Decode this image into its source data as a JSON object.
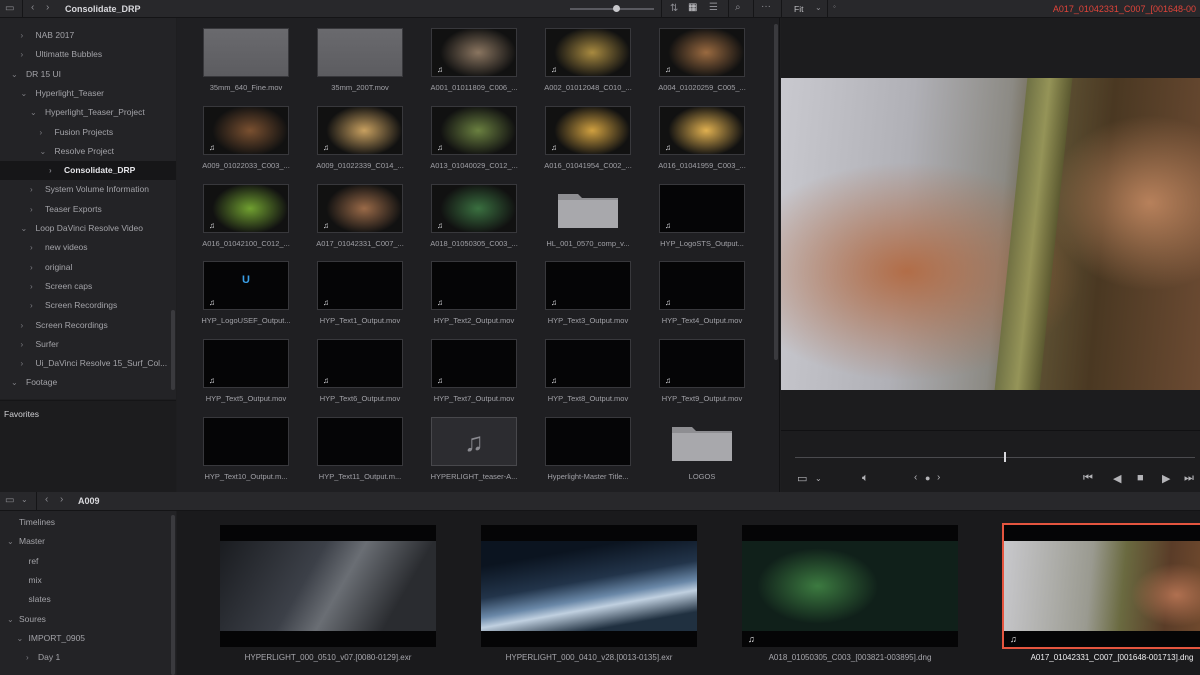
{
  "top": {
    "title": "Consolidate_DRP",
    "fit": "Fit",
    "clip": "A017_01042331_C007_[001648-00"
  },
  "tree": [
    {
      "label": "NAB 2017",
      "depth": 1,
      "chev": "›"
    },
    {
      "label": "Ultimatte Bubbles",
      "depth": 1,
      "chev": "›"
    },
    {
      "label": "DR 15 UI",
      "depth": 0,
      "chev": "⌄"
    },
    {
      "label": "Hyperlight_Teaser",
      "depth": 1,
      "chev": "⌄"
    },
    {
      "label": "Hyperlight_Teaser_Project",
      "depth": 2,
      "chev": "⌄"
    },
    {
      "label": "Fusion Projects",
      "depth": 3,
      "chev": "›"
    },
    {
      "label": "Resolve Project",
      "depth": 3,
      "chev": "⌄"
    },
    {
      "label": "Consolidate_DRP",
      "depth": 4,
      "chev": "›",
      "selected": true
    },
    {
      "label": "System Volume Information",
      "depth": 2,
      "chev": "›"
    },
    {
      "label": "Teaser Exports",
      "depth": 2,
      "chev": "›"
    },
    {
      "label": "Loop DaVinci Resolve Video",
      "depth": 1,
      "chev": "⌄"
    },
    {
      "label": "new videos",
      "depth": 2,
      "chev": "›"
    },
    {
      "label": "original",
      "depth": 2,
      "chev": "›"
    },
    {
      "label": "Screen caps",
      "depth": 2,
      "chev": "›"
    },
    {
      "label": "Screen Recordings",
      "depth": 2,
      "chev": "›"
    },
    {
      "label": "Screen Recordings",
      "depth": 1,
      "chev": "›"
    },
    {
      "label": "Surfer",
      "depth": 1,
      "chev": "›"
    },
    {
      "label": "Ui_DaVinci Resolve 15_Surf_Col...",
      "depth": 1,
      "chev": "›"
    },
    {
      "label": "Footage",
      "depth": 0,
      "chev": "⌄"
    }
  ],
  "favorites": "Favorites",
  "pool": [
    {
      "name": "35mm_640_Fine.mov",
      "kind": "gray"
    },
    {
      "name": "35mm_200T.mov",
      "kind": "gray"
    },
    {
      "name": "A001_01011809_C006_...",
      "kind": "video",
      "tone": "#8a7560",
      "audio": true
    },
    {
      "name": "A002_01012048_C010_...",
      "kind": "video",
      "tone": "#a88a40",
      "audio": true
    },
    {
      "name": "A004_01020259_C005_...",
      "kind": "video",
      "tone": "#9a6a40",
      "audio": true
    },
    {
      "name": "A009_01022033_C003_...",
      "kind": "video",
      "tone": "#7a5030",
      "audio": true
    },
    {
      "name": "A009_01022339_C014_...",
      "kind": "video",
      "tone": "#c8a060",
      "audio": true
    },
    {
      "name": "A013_01040029_C012_...",
      "kind": "video",
      "tone": "#6a8040",
      "audio": true
    },
    {
      "name": "A016_01041954_C002_...",
      "kind": "video",
      "tone": "#d0a040",
      "audio": true
    },
    {
      "name": "A016_01041959_C003_...",
      "kind": "video",
      "tone": "#e0b050",
      "audio": true
    },
    {
      "name": "A016_01042100_C012_...",
      "kind": "video",
      "tone": "#70a030",
      "audio": true
    },
    {
      "name": "A017_01042331_C007_...",
      "kind": "video",
      "tone": "#9a6a48",
      "audio": true
    },
    {
      "name": "A018_01050305_C003_...",
      "kind": "video",
      "tone": "#3a7040",
      "audio": true
    },
    {
      "name": "HL_001_0570_comp_v...",
      "kind": "folder"
    },
    {
      "name": "HYP_LogoSTS_Output...",
      "kind": "dark",
      "audio": true
    },
    {
      "name": "HYP_LogoUSEF_Output...",
      "kind": "dark",
      "audio": true,
      "glyph": "U"
    },
    {
      "name": "HYP_Text1_Output.mov",
      "kind": "dark",
      "audio": true
    },
    {
      "name": "HYP_Text2_Output.mov",
      "kind": "dark",
      "audio": true
    },
    {
      "name": "HYP_Text3_Output.mov",
      "kind": "dark",
      "audio": true
    },
    {
      "name": "HYP_Text4_Output.mov",
      "kind": "dark",
      "audio": true
    },
    {
      "name": "HYP_Text5_Output.mov",
      "kind": "dark",
      "audio": true
    },
    {
      "name": "HYP_Text6_Output.mov",
      "kind": "dark",
      "audio": true
    },
    {
      "name": "HYP_Text7_Output.mov",
      "kind": "dark",
      "audio": true
    },
    {
      "name": "HYP_Text8_Output.mov",
      "kind": "dark",
      "audio": true
    },
    {
      "name": "HYP_Text9_Output.mov",
      "kind": "dark",
      "audio": true
    },
    {
      "name": "HYP_Text10_Output.m...",
      "kind": "dark"
    },
    {
      "name": "HYP_Text11_Output.m...",
      "kind": "dark"
    },
    {
      "name": "HYPERLIGHT_teaser-A...",
      "kind": "audio"
    },
    {
      "name": "Hyperlight-Master Title...",
      "kind": "dark"
    },
    {
      "name": "LOGOS",
      "kind": "folder"
    }
  ],
  "bottom": {
    "title": "A009",
    "tree": [
      {
        "label": "Timelines",
        "depth": 0,
        "chev": ""
      },
      {
        "label": "Master",
        "depth": 0,
        "chev": "⌄"
      },
      {
        "label": "ref",
        "depth": 1,
        "chev": ""
      },
      {
        "label": "mix",
        "depth": 1,
        "chev": ""
      },
      {
        "label": "slates",
        "depth": 1,
        "chev": ""
      },
      {
        "label": "Soures",
        "depth": 0,
        "chev": "⌄"
      },
      {
        "label": "IMPORT_0905",
        "depth": 1,
        "chev": "⌄"
      },
      {
        "label": "Day 1",
        "depth": 2,
        "chev": "›"
      }
    ],
    "clips": [
      {
        "name": "HYPERLIGHT_000_0510_v07.[0080-0129].exr",
        "bg": "linear-gradient(120deg,#1a1c20,#3c4048 40%,#6a6e74 55%,#2a2c30 80%)"
      },
      {
        "name": "HYPERLIGHT_000_0410_v28.[0013-0135].exr",
        "bg": "linear-gradient(170deg,#0b1420 20%,#22344a 45%,#6a88a8 60%,#c0d0e0 68%,#203040 85%)"
      },
      {
        "name": "A018_01050305_C003_[003821-003895].dng",
        "bg": "radial-gradient(ellipse 40% 60% at 35% 50%,#3c7a40,#10201a 70%),#0c140e",
        "audio": true
      },
      {
        "name": "A017_01042331_C007_[001648-001713].dng",
        "bg": "radial-gradient(ellipse 30% 50% at 80% 60%,#b07050,rgba(0,0,0,0) 70%),linear-gradient(95deg,#c8c8cc 0%,#9a9a90 40%,#6a6a40 55%,#5a3c28 75%,#7a5030)",
        "audio": true,
        "selected": true
      }
    ]
  }
}
